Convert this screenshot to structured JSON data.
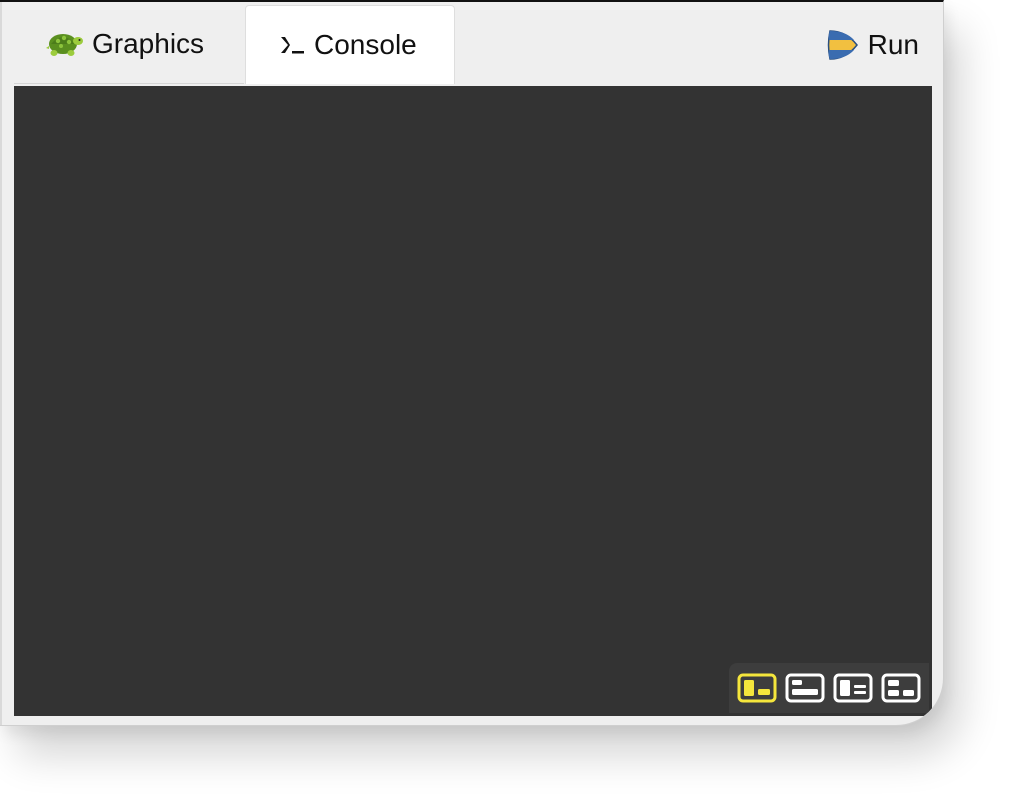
{
  "tabs": [
    {
      "label": "Graphics",
      "icon": "turtle-icon",
      "active": false
    },
    {
      "label": "Console",
      "icon": "terminal-prompt-icon",
      "active": true
    }
  ],
  "run_button": {
    "label": "Run",
    "icon": "run-icon"
  },
  "layout_toolbar": {
    "buttons": [
      {
        "icon": "layout-split-left-icon",
        "selected": true
      },
      {
        "icon": "layout-bottom-panel-icon",
        "selected": false
      },
      {
        "icon": "layout-side-list-icon",
        "selected": false
      },
      {
        "icon": "layout-grid-icon",
        "selected": false
      }
    ]
  },
  "colors": {
    "console_background": "#333333",
    "tabbar_background": "#efefef",
    "active_tab_background": "#ffffff",
    "selected_layout": "#f5e63c",
    "layout_icon": "#ffffff"
  }
}
